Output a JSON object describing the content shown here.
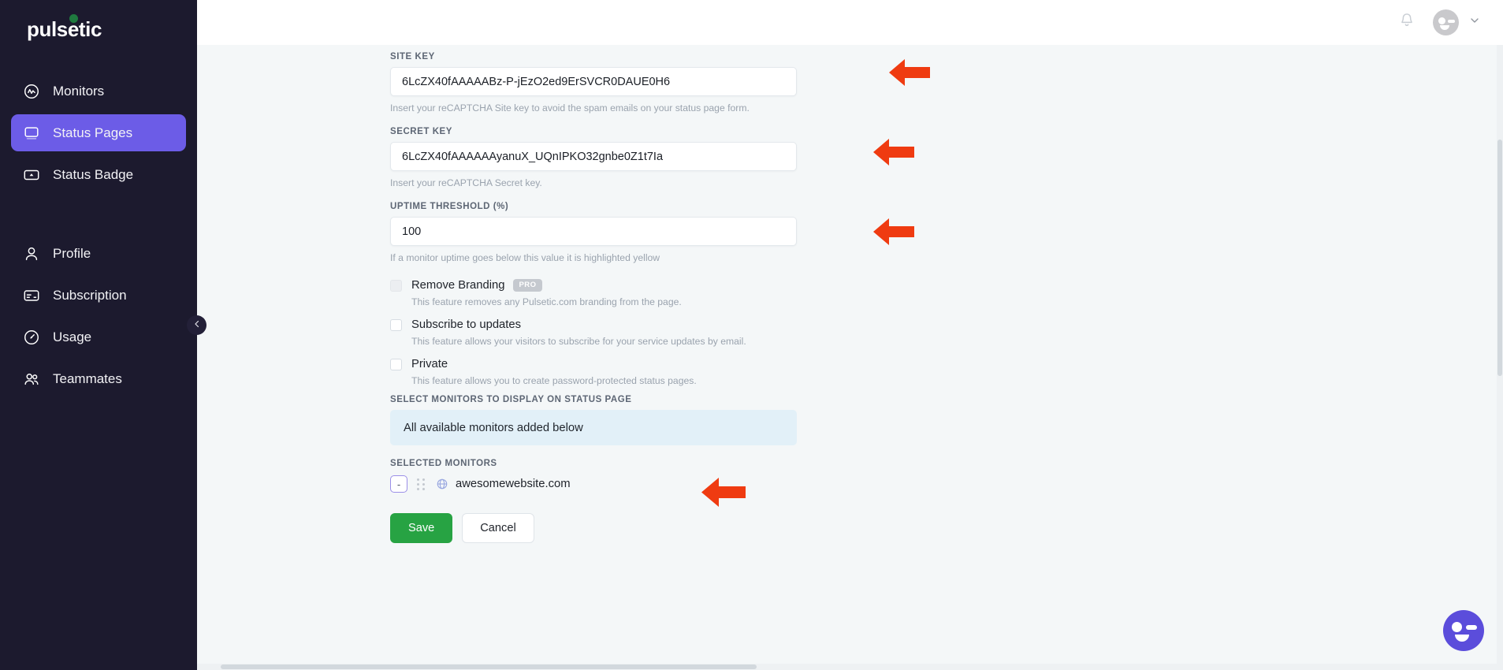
{
  "brand": {
    "name": "pulsetic"
  },
  "sidebar": {
    "groups": [
      {
        "items": [
          {
            "label": "Monitors",
            "icon": "monitor-pulse-icon",
            "active": false
          },
          {
            "label": "Status Pages",
            "icon": "status-page-icon",
            "active": true
          },
          {
            "label": "Status Badge",
            "icon": "status-badge-icon",
            "active": false
          }
        ]
      },
      {
        "items": [
          {
            "label": "Profile",
            "icon": "person-icon",
            "active": false
          },
          {
            "label": "Subscription",
            "icon": "card-icon",
            "active": false
          },
          {
            "label": "Usage",
            "icon": "gauge-icon",
            "active": false
          },
          {
            "label": "Teammates",
            "icon": "people-icon",
            "active": false
          }
        ]
      }
    ],
    "collapse_handle": "chevron-left-icon"
  },
  "topbar": {
    "notification_icon": "bell-icon",
    "avatar_icon": "user-avatar",
    "dropdown_icon": "chevron-down-icon"
  },
  "form": {
    "site_key": {
      "label": "SITE KEY",
      "value": "6LcZX40fAAAAABz-P-jEzO2ed9ErSVCR0DAUE0H6",
      "hint": "Insert your reCAPTCHA Site key to avoid the spam emails on your status page form."
    },
    "secret_key": {
      "label": "SECRET KEY",
      "value": "6LcZX40fAAAAAAyanuX_UQnIPKO32gnbe0Z1t7Ia",
      "hint": "Insert your reCAPTCHA Secret key."
    },
    "uptime_threshold": {
      "label": "UPTIME THRESHOLD (%)",
      "value": "100",
      "hint": "If a monitor uptime goes below this value it is highlighted yellow"
    },
    "checkboxes": [
      {
        "title": "Remove Branding",
        "badge": "PRO",
        "desc": "This feature removes any Pulsetic.com branding from the page.",
        "checked": false,
        "disabled": true
      },
      {
        "title": "Subscribe to updates",
        "badge": "",
        "desc": "This feature allows your visitors to subscribe for your service updates by email.",
        "checked": false,
        "disabled": false
      },
      {
        "title": "Private",
        "badge": "",
        "desc": "This feature allows you to create password-protected status pages.",
        "checked": false,
        "disabled": false
      }
    ],
    "select_monitors": {
      "label": "SELECT MONITORS TO DISPLAY ON STATUS PAGE",
      "placeholder": "All available monitors added below"
    },
    "selected_monitors": {
      "label": "SELECTED MONITORS",
      "items": [
        {
          "remove_label": "-",
          "drag_icon": "drag-handle-icon",
          "type_icon": "globe-icon",
          "name": "awesomewebsite.com"
        }
      ]
    },
    "actions": {
      "save_label": "Save",
      "cancel_label": "Cancel"
    }
  },
  "annotations": {
    "arrow_color": "#ef3b11",
    "arrows": [
      {
        "target": "site-key-input"
      },
      {
        "target": "secret-key-input"
      },
      {
        "target": "uptime-threshold-input"
      },
      {
        "target": "selected-monitor-row"
      }
    ]
  },
  "chat_widget": {
    "icon": "chat-avatar-icon"
  },
  "colors": {
    "sidebar_bg": "#1c1a2e",
    "accent": "#6c5ce7",
    "save_green": "#27a343",
    "page_bg": "#f4f7f8",
    "info_box": "#e2f0f8"
  }
}
